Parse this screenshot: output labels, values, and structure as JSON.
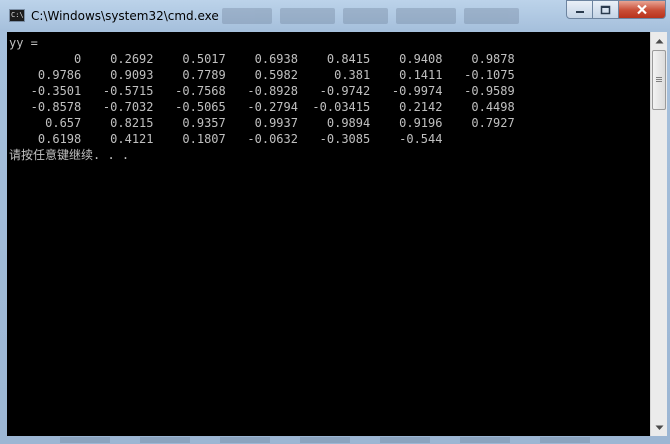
{
  "window": {
    "title": "C:\\Windows\\system32\\cmd.exe",
    "icon_label": "C:\\",
    "buttons": {
      "minimize": "minimize-icon",
      "maximize": "maximize-icon",
      "close": "close-icon"
    }
  },
  "console": {
    "lines": [
      "yy =",
      "         0    0.2692    0.5017    0.6938    0.8415    0.9408    0.9878",
      "    0.9786    0.9093    0.7789    0.5982     0.381    0.1411   -0.1075",
      "   -0.3501   -0.5715   -0.7568   -0.8928   -0.9742   -0.9974   -0.9589",
      "   -0.8578   -0.7032   -0.5065   -0.2794  -0.03415    0.2142    0.4498",
      "     0.657    0.8215    0.9357    0.9937    0.9894    0.9196    0.7927",
      "    0.6198    0.4121    0.1807   -0.0632   -0.3085    -0.544",
      "请按任意键继续. . ."
    ],
    "text_color": "#c0c0c0",
    "background": "#000000"
  },
  "scrollbar": {
    "up": "scroll-up-arrow-icon",
    "down": "scroll-down-arrow-icon"
  }
}
